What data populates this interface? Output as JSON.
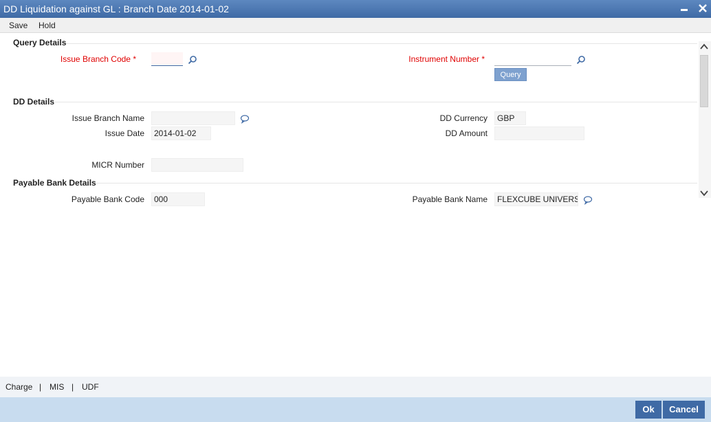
{
  "window": {
    "title": "DD Liquidation against GL : Branch Date 2014-01-02",
    "minimize_icon": "minimize-icon",
    "close_icon": "close-icon"
  },
  "menu": {
    "save_label": "Save",
    "hold_label": "Hold"
  },
  "query_details": {
    "section_title": "Query Details",
    "issue_branch_code_label": "Issue Branch Code",
    "issue_branch_code_value": "",
    "instrument_number_label": "Instrument Number",
    "instrument_number_value": "",
    "required_marker": "*",
    "query_button": "Query"
  },
  "dd_details": {
    "section_title": "DD Details",
    "issue_branch_name_label": "Issue Branch Name",
    "issue_branch_name_value": "",
    "issue_date_label": "Issue Date",
    "issue_date_value": "2014-01-02",
    "micr_number_label": "MICR Number",
    "micr_number_value": "",
    "dd_currency_label": "DD Currency",
    "dd_currency_value": "GBP",
    "dd_amount_label": "DD Amount",
    "dd_amount_value": ""
  },
  "payable_bank_details": {
    "section_title": "Payable Bank Details",
    "payable_bank_code_label": "Payable Bank Code",
    "payable_bank_code_value": "000",
    "payable_bank_name_label": "Payable Bank Name",
    "payable_bank_name_value": "FLEXCUBE UNIVERSAL BANK"
  },
  "subscreens": {
    "charge": "Charge",
    "mis": "MIS",
    "udf": "UDF",
    "separator": "|"
  },
  "footer": {
    "ok_label": "Ok",
    "cancel_label": "Cancel"
  },
  "colors": {
    "title_bar": "#4a76b0",
    "required_label": "#e00000",
    "footer_bg": "#c8dcef",
    "button_bg": "#3f6aa5"
  }
}
